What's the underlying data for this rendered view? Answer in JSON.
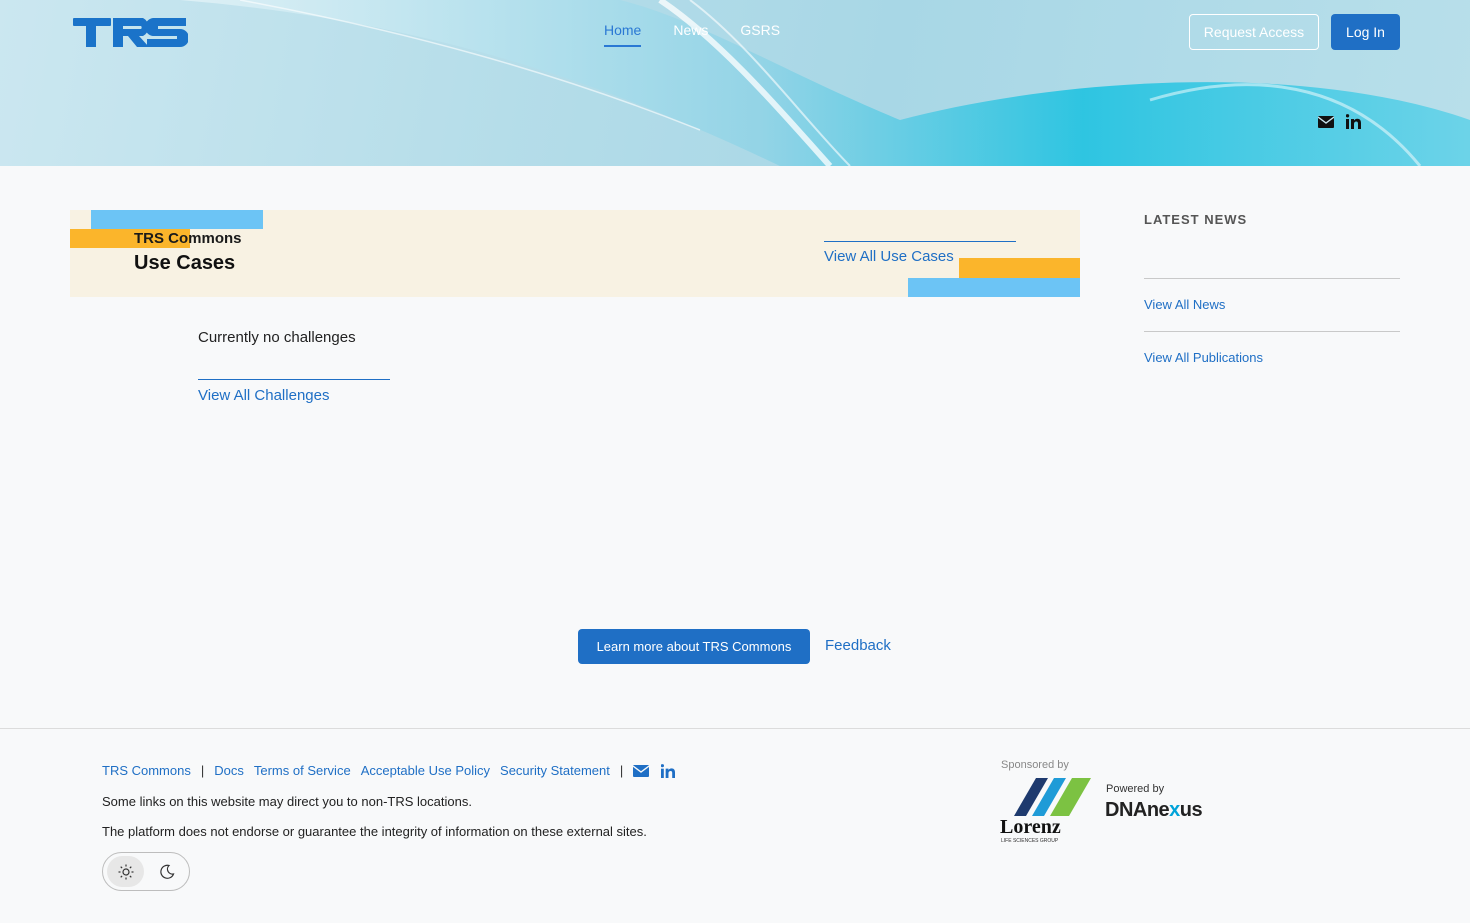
{
  "header": {
    "logo_text": "TRS",
    "nav": [
      {
        "label": "Home",
        "active": true
      },
      {
        "label": "News",
        "active": false
      },
      {
        "label": "GSRS",
        "active": false
      }
    ],
    "request_access_label": "Request Access",
    "login_label": "Log In",
    "social_icons": [
      "envelope-icon",
      "linkedin-icon"
    ]
  },
  "use_cases": {
    "kicker": "TRS Commons",
    "title": "Use Cases",
    "view_all_label": "View All Use Cases"
  },
  "challenges": {
    "empty_message": "Currently no challenges",
    "view_all_label": "View All Challenges"
  },
  "sidebar": {
    "heading": "LATEST NEWS",
    "view_all_news": "View All News",
    "view_all_publications": "View All Publications"
  },
  "cta": {
    "learn_more_label": "Learn more about TRS Commons",
    "feedback_label": "Feedback"
  },
  "footer": {
    "links": [
      "TRS Commons",
      "Docs",
      "Terms of Service",
      "Acceptable Use Policy",
      "Security Statement"
    ],
    "separator": "|",
    "note_1": "Some links on this website may direct you to non-TRS locations.",
    "note_2": "The platform does not endorse or guarantee the integrity of information on these external sites.",
    "theme_options": [
      "sun-icon",
      "moon-icon"
    ],
    "sponsored_by": "Sponsored by",
    "sponsor_name": "Lorenz",
    "sponsor_sub": "LIFE SCIENCES GROUP",
    "powered_by": "Powered by",
    "platform_name_pre": "DNAne",
    "platform_name_x": "x",
    "platform_name_post": "us"
  },
  "colors": {
    "accent": "#1f6fc5",
    "card_bg": "#f8f2e3",
    "deco_blue": "#6cc4f5",
    "deco_orange": "#fbb52b"
  }
}
